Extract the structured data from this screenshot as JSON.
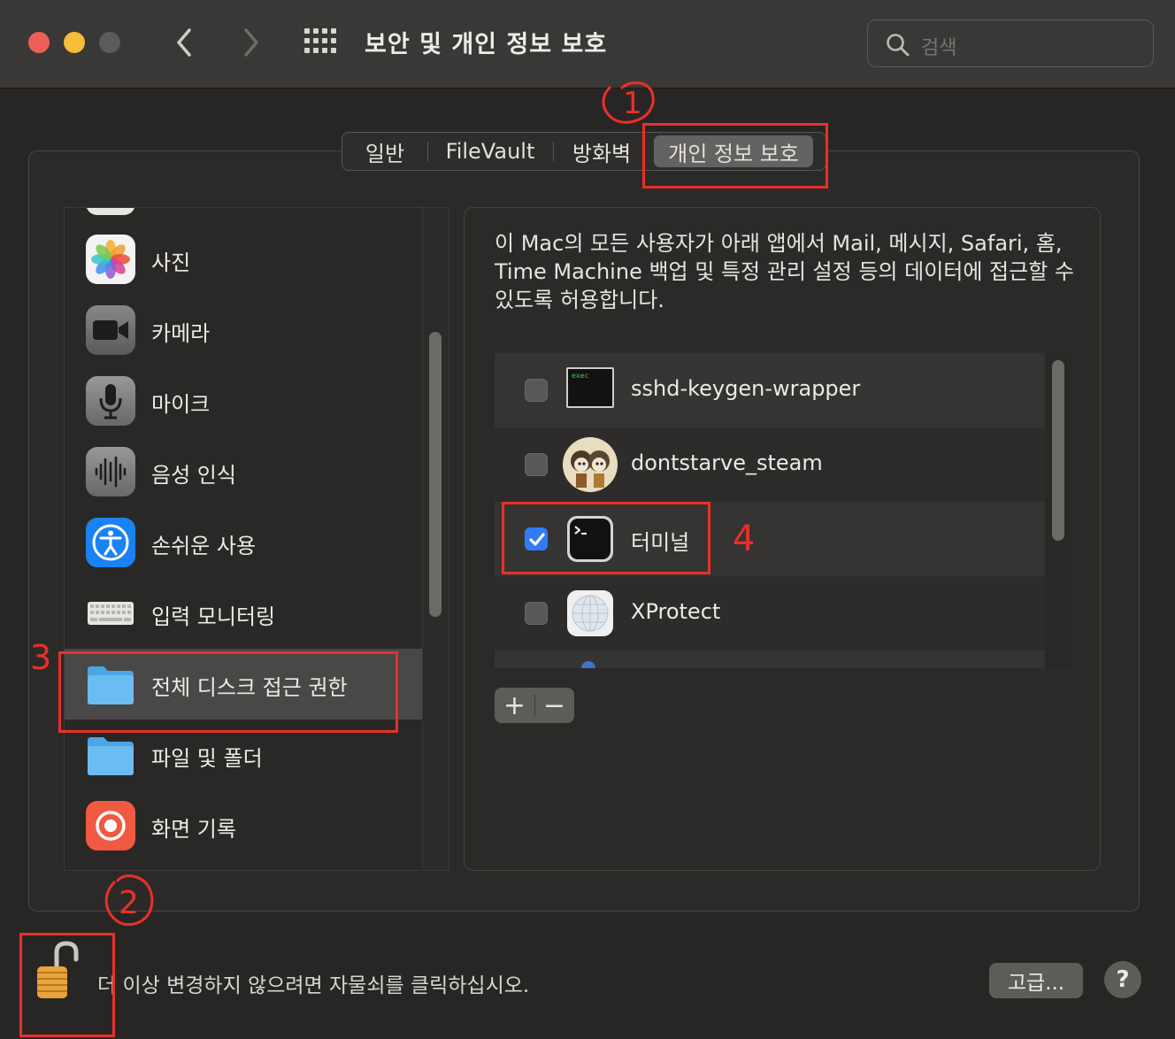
{
  "window": {
    "title": "보안 및 개인 정보 보호",
    "search_placeholder": "검색"
  },
  "tabs": [
    {
      "label": "일반"
    },
    {
      "label": "FileVault"
    },
    {
      "label": "방화벽"
    },
    {
      "label": "개인 정보 보호",
      "selected": true
    }
  ],
  "sidebar": {
    "items": [
      {
        "label": "사진",
        "icon": "photos-icon"
      },
      {
        "label": "카메라",
        "icon": "camera-icon"
      },
      {
        "label": "마이크",
        "icon": "microphone-icon"
      },
      {
        "label": "음성 인식",
        "icon": "speech-recognition-icon"
      },
      {
        "label": "손쉬운 사용",
        "icon": "accessibility-icon"
      },
      {
        "label": "입력 모니터링",
        "icon": "keyboard-icon"
      },
      {
        "label": "전체 디스크 접근 권한",
        "icon": "folder-icon",
        "selected": true
      },
      {
        "label": "파일 및 폴더",
        "icon": "folder-icon"
      },
      {
        "label": "화면 기록",
        "icon": "screen-recording-icon"
      }
    ]
  },
  "main": {
    "description": "이 Mac의 모든 사용자가 아래 앱에서 Mail, 메시지, Safari, 홈, Time Machine 백업 및 특정 관리 설정 등의 데이터에 접근할 수 있도록 허용합니다.",
    "apps": [
      {
        "name": "sshd-keygen-wrapper",
        "checked": false,
        "icon": "exec-icon"
      },
      {
        "name": "dontstarve_steam",
        "checked": false,
        "icon": "game-icon"
      },
      {
        "name": "터미널",
        "checked": true,
        "icon": "terminal-icon"
      },
      {
        "name": "XProtect",
        "checked": false,
        "icon": "xprotect-icon"
      }
    ],
    "exec_icon_text": "exec",
    "add_label": "+",
    "remove_label": "−"
  },
  "footer": {
    "lock_message": "더 이상 변경하지 않으려면 자물쇠를 클릭하십시오.",
    "advanced_label": "고급...",
    "help_label": "?"
  },
  "annotations": {
    "step1": "1",
    "step2": "2",
    "step3": "3",
    "step4": "4",
    "color": "#e8302a"
  },
  "colors": {
    "accent": "#2f7cf6",
    "close": "#ec5f57",
    "minimize": "#f4bd3a"
  }
}
